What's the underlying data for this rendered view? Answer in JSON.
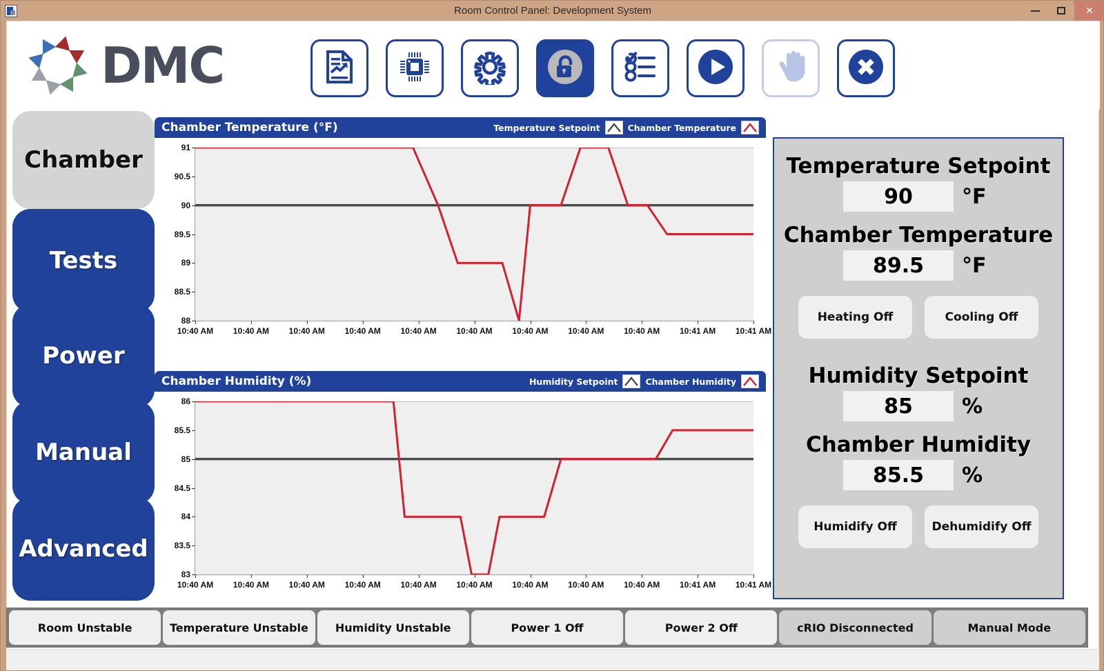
{
  "window": {
    "title": "Room Control Panel: Development System",
    "app_icon": "labview-vi-icon",
    "minimize_label": "",
    "maximize_label": "",
    "close_label": "✕"
  },
  "brand": {
    "text": "DMC",
    "logo_icon": "dmc-radial-logo",
    "wedge_colors": [
      "#3a6fb5",
      "#3a6fb5",
      "#9aa0a6",
      "#9aa0a6",
      "#5f9370",
      "#5f9370",
      "#a32b2b",
      "#a32b2b"
    ]
  },
  "toolbar": {
    "buttons": [
      {
        "name": "report-button",
        "icon": "document-chart-icon",
        "state": "normal"
      },
      {
        "name": "hardware-button",
        "icon": "chip-icon",
        "state": "normal"
      },
      {
        "name": "settings-button",
        "icon": "gear-icon",
        "state": "normal"
      },
      {
        "name": "lock-button",
        "icon": "unlock-icon",
        "state": "active"
      },
      {
        "name": "checklist-button",
        "icon": "checklist-icon",
        "state": "normal"
      },
      {
        "name": "run-button",
        "icon": "play-icon",
        "state": "normal"
      },
      {
        "name": "hold-button",
        "icon": "hand-icon",
        "state": "disabled"
      },
      {
        "name": "stop-button",
        "icon": "close-circle-icon",
        "state": "normal"
      }
    ]
  },
  "sidebar": {
    "items": [
      {
        "label": "Chamber",
        "active": true
      },
      {
        "label": "Tests",
        "active": false
      },
      {
        "label": "Power",
        "active": false
      },
      {
        "label": "Manual",
        "active": false
      },
      {
        "label": "Advanced",
        "active": false
      }
    ]
  },
  "chart_data": [
    {
      "type": "line",
      "name": "temperature-chart",
      "title": "Chamber Temperature (°F)",
      "xlabel": "",
      "ylabel": "",
      "ylim": [
        88,
        91
      ],
      "yticks": [
        88,
        88.5,
        89,
        89.5,
        90,
        90.5,
        91
      ],
      "ytick_labels": [
        "88",
        "88.5",
        "89",
        "89.5",
        "90",
        "90.5",
        "91"
      ],
      "xticks": [
        0,
        1,
        2,
        3,
        4,
        5,
        6,
        7,
        8,
        9,
        10
      ],
      "xtick_labels": [
        "10:40 AM",
        "10:40 AM",
        "10:40 AM",
        "10:40 AM",
        "10:40 AM",
        "10:40 AM",
        "10:40 AM",
        "10:40 AM",
        "10:40 AM",
        "10:41 AM",
        "10:41 AM"
      ],
      "grid": false,
      "legend_position": "header-right",
      "series": [
        {
          "name": "Temperature Setpoint",
          "color": "#4a4a4a",
          "x": [
            0,
            10
          ],
          "values": [
            90,
            90
          ]
        },
        {
          "name": "Chamber Temperature",
          "color": "#d32030",
          "x": [
            0,
            3.9,
            4.35,
            4.7,
            5.5,
            5.8,
            6.0,
            6.55,
            6.9,
            7.4,
            7.75,
            8.1,
            8.45,
            10
          ],
          "values": [
            91,
            91,
            90,
            89,
            89,
            88,
            90,
            90,
            91,
            91,
            90,
            90,
            89.5,
            89.5
          ]
        }
      ]
    },
    {
      "type": "line",
      "name": "humidity-chart",
      "title": "Chamber Humidity (%)",
      "xlabel": "",
      "ylabel": "",
      "ylim": [
        83,
        86
      ],
      "yticks": [
        83,
        83.5,
        84,
        84.5,
        85,
        85.5,
        86
      ],
      "ytick_labels": [
        "83",
        "83.5",
        "84",
        "84.5",
        "85",
        "85.5",
        "86"
      ],
      "xticks": [
        0,
        1,
        2,
        3,
        4,
        5,
        6,
        7,
        8,
        9,
        10
      ],
      "xtick_labels": [
        "10:40 AM",
        "10:40 AM",
        "10:40 AM",
        "10:40 AM",
        "10:40 AM",
        "10:40 AM",
        "10:40 AM",
        "10:40 AM",
        "10:40 AM",
        "10:41 AM",
        "10:41 AM"
      ],
      "grid": false,
      "legend_position": "header-right",
      "series": [
        {
          "name": "Humidity Setpoint",
          "color": "#4a4a4a",
          "x": [
            0,
            10
          ],
          "values": [
            85,
            85
          ]
        },
        {
          "name": "Chamber Humidity",
          "color": "#d32030",
          "x": [
            0,
            3.55,
            3.75,
            4.75,
            4.95,
            5.25,
            5.45,
            6.25,
            6.55,
            8.25,
            8.55,
            10
          ],
          "values": [
            86,
            86,
            84,
            84,
            83,
            83,
            84,
            84,
            85,
            85,
            85.5,
            85.5
          ]
        }
      ]
    }
  ],
  "control_panel": {
    "groups": [
      {
        "setpoint_label": "Temperature Setpoint",
        "setpoint_value": "90",
        "setpoint_unit": "°F",
        "reading_label": "Chamber Temperature",
        "reading_value": "89.5",
        "reading_unit": "°F",
        "buttons": [
          "Heating Off",
          "Cooling Off"
        ]
      },
      {
        "setpoint_label": "Humidity Setpoint",
        "setpoint_value": "85",
        "setpoint_unit": "%",
        "reading_label": "Chamber Humidity",
        "reading_value": "85.5",
        "reading_unit": "%",
        "buttons": [
          "Humidify Off",
          "Dehumidify Off"
        ]
      }
    ]
  },
  "status_bar": {
    "items": [
      {
        "label": "Room Unstable",
        "dim": false
      },
      {
        "label": "Temperature Unstable",
        "dim": false
      },
      {
        "label": "Humidity Unstable",
        "dim": false
      },
      {
        "label": "Power 1 Off",
        "dim": false
      },
      {
        "label": "Power 2 Off",
        "dim": false
      },
      {
        "label": "cRIO Disconnected",
        "dim": true
      },
      {
        "label": "Manual Mode",
        "dim": true
      }
    ]
  },
  "colors": {
    "brand_blue": "#20429a",
    "trace_red": "#d32030",
    "setpoint_gray": "#4a4a4a",
    "window_chrome": "#cda484",
    "plot_bg": "#efefef"
  }
}
